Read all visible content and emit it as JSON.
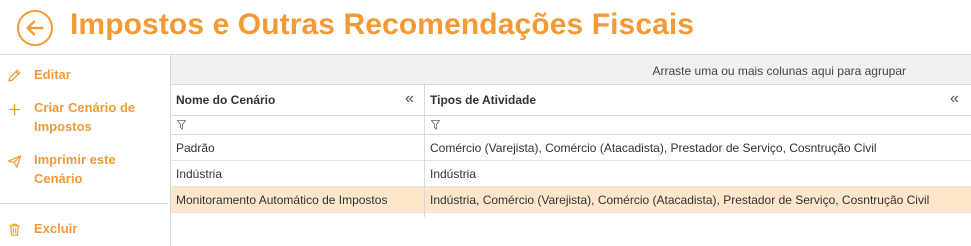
{
  "header": {
    "title": "Impostos e Outras Recomendações Fiscais",
    "back_icon": "arrow-left-circle-icon"
  },
  "colors": {
    "accent": "#f39a34",
    "selected_row": "#fde6cc",
    "group_panel_bg": "#f1f1f1"
  },
  "sidebar": {
    "items": [
      {
        "label": "Editar",
        "icon": "pencil-icon"
      },
      {
        "label": "Criar Cenário de\nImpostos",
        "icon": "plus-icon"
      },
      {
        "label": "Imprimir este\nCenário",
        "icon": "send-icon"
      },
      {
        "label": "Excluir",
        "icon": "trash-icon"
      }
    ]
  },
  "grid": {
    "group_panel_text": "Arraste uma ou mais colunas aqui para agrupar",
    "columns": [
      {
        "label": "Nome do Cenário",
        "collapse": "«"
      },
      {
        "label": "Tipos de Atividade",
        "collapse": "«"
      }
    ],
    "rows": [
      {
        "name": "Padrão",
        "activities": "Comércio (Varejista), Comércio (Atacadista), Prestador de Serviço, Cosntrução Civil",
        "selected": false
      },
      {
        "name": "Indústria",
        "activities": "Indústria",
        "selected": false
      },
      {
        "name": "Monitoramento Automático de Impostos",
        "activities": "Indústria, Comércio (Varejista), Comércio (Atacadista), Prestador de Serviço, Cosntrução Civil",
        "selected": true
      }
    ]
  }
}
